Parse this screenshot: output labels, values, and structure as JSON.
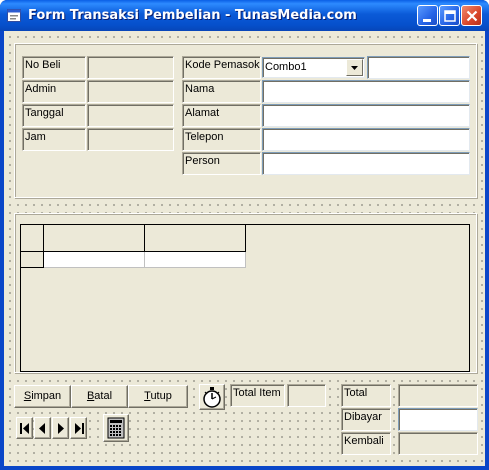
{
  "window": {
    "title": "Form Transaksi Pembelian - TunasMedia.com",
    "title_bar_color": "#0A5FE6",
    "close_color": "#D9452A"
  },
  "header": {
    "left_labels": [
      "No Beli",
      "Admin",
      "Tanggal",
      "Jam"
    ],
    "supplier": {
      "kode_label": "Kode Pemasok",
      "combo_value": "Combo1",
      "labels": [
        "Nama",
        "Alamat",
        "Telepon",
        "Person"
      ]
    }
  },
  "grid": {
    "columns": [
      "",
      ""
    ],
    "rows": [
      [
        "",
        ""
      ]
    ]
  },
  "actions": {
    "simpan_pre": "",
    "simpan_key": "S",
    "simpan_post": "impan",
    "batal_pre": "",
    "batal_key": "B",
    "batal_post": "atal",
    "tutup_pre": "",
    "tutup_key": "T",
    "tutup_post": "utup"
  },
  "summary": {
    "total_item_label": "Total Item",
    "total_label": "Total",
    "dibayar_label": "Dibayar",
    "kembali_label": "Kembali"
  },
  "icons": {
    "timer": "stopwatch-icon",
    "calculator": "calculator-icon"
  }
}
